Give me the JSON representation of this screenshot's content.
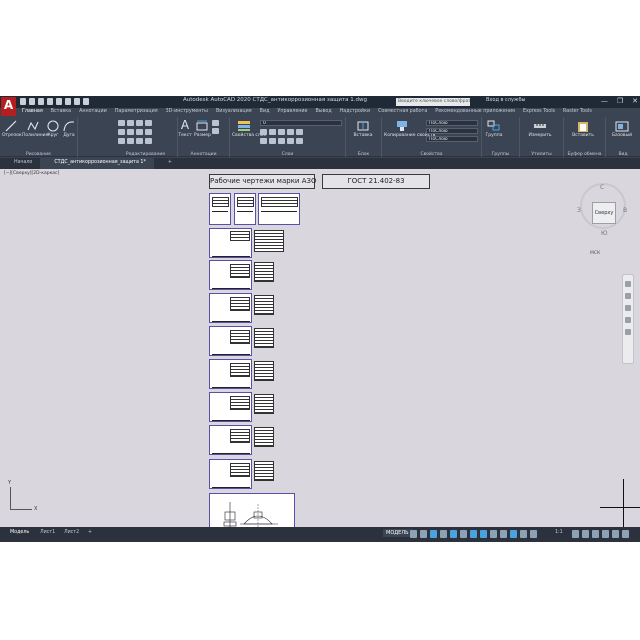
{
  "titlebar": {
    "logo": "A",
    "app_title": "Autodesk AutoCAD 2020   СТДС_антикоррозионная защита 1.dwg",
    "search_placeholder": "Введите ключевое слово/фразу",
    "signin": "Вход в службы",
    "controls": [
      "—",
      "❐",
      "✕"
    ]
  },
  "menu_tabs": [
    "Главная",
    "Вставка",
    "Аннотации",
    "Параметризация",
    "3D-инструменты",
    "Визуализация",
    "Вид",
    "Управление",
    "Вывод",
    "Надстройки",
    "Совместная работа",
    "Рекомендованные приложения",
    "Express Tools",
    "Raster Tools"
  ],
  "active_menu_tab": 0,
  "ribbon": {
    "draw": {
      "label": "Рисование",
      "tools": [
        "Отрезок",
        "Полилиния",
        "Круг",
        "Дуга"
      ]
    },
    "modify": {
      "label": "Редактирование"
    },
    "annotation": {
      "label": "Аннотации",
      "tools": [
        "Текст",
        "Размер"
      ]
    },
    "layers": {
      "label": "Слои",
      "tools": [
        "Свойства слоя"
      ],
      "current_layer": "0"
    },
    "block": {
      "label": "Блок",
      "tools": [
        "Вставка"
      ]
    },
    "properties": {
      "label": "Свойства",
      "tools": [
        "Копирование свойств"
      ],
      "color": "ПоСлою",
      "linetype": "ПоСлою",
      "lineweight": "ПоСлою"
    },
    "groups": {
      "label": "Группы",
      "tools": [
        "Группа"
      ]
    },
    "utilities": {
      "label": "Утилиты",
      "tools": [
        "Измерить"
      ]
    },
    "clipboard": {
      "label": "Буфер обмена",
      "tools": [
        "Вставить"
      ]
    },
    "view": {
      "label": "Вид",
      "tools": [
        "Базовый"
      ]
    }
  },
  "file_tabs": [
    "Начало",
    "СТДС_антикоррозионная_защита 1*",
    "+"
  ],
  "active_file_tab": 1,
  "canvas": {
    "viewport_label": "[−][Сверху][2D-каркас]",
    "header_left": "Рабочие чертежи марки АЗО",
    "header_right": "ГОСТ 21.402-83",
    "viewcube_face": "Сверху",
    "compass": {
      "n": "С",
      "s": "Ю",
      "w": "З",
      "e": "В"
    },
    "wcs": "МСК",
    "ucs_x": "X",
    "ucs_y": "Y"
  },
  "statusbar": {
    "layout_tabs": [
      "Модель",
      "Лист1",
      "Лист2",
      "+"
    ],
    "active_layout": 0,
    "model_button": "МОДЕЛЬ",
    "scale": "1:1"
  },
  "colors": {
    "titlebar": "#1f2a36",
    "ribbon": "#3b4453",
    "canvas": "#d9d7dd",
    "sheet_border": "#5b4fa8",
    "logo": "#b51e20"
  }
}
